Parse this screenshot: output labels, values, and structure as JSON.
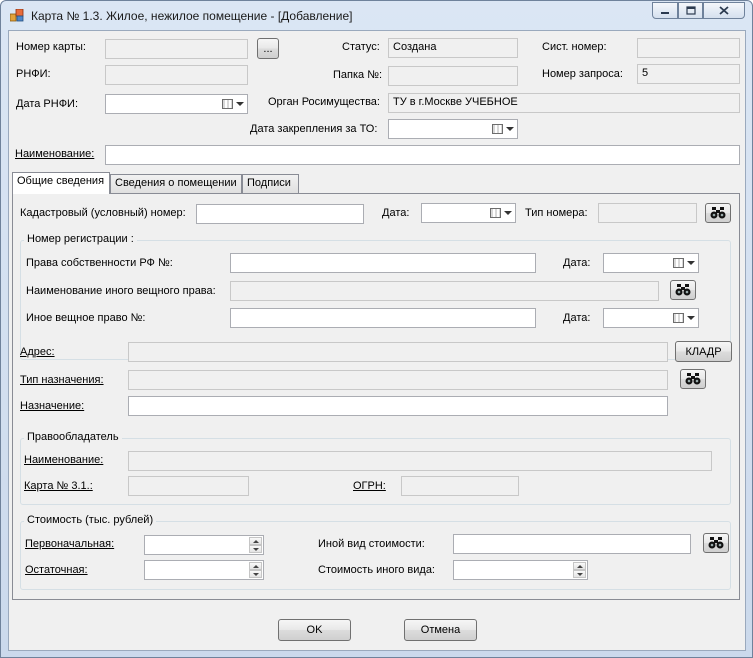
{
  "window": {
    "title": "Карта № 1.3. Жилое, нежилое помещение - [Добавление]",
    "controls": [
      "minimize-icon",
      "maximize-icon",
      "close-icon"
    ]
  },
  "header": {
    "card_number_label": "Номер карты:",
    "card_number_value": "",
    "browse_button_label": "...",
    "status_label": "Статус:",
    "status_value": "Создана",
    "sys_number_label": "Сист. номер:",
    "sys_number_value": "",
    "rnfi_label": "РНФИ:",
    "rnfi_value": "",
    "folder_label": "Папка №:",
    "folder_value": "",
    "request_number_label": "Номер запроса:",
    "request_number_value": "5",
    "rnfi_date_label": "Дата РНФИ:",
    "rnfi_date_value": "",
    "agency_label": "Орган Росимущества:",
    "agency_value": "ТУ в г.Москве УЧЕБНОЕ",
    "assign_date_label": "Дата закрепления за ТО:",
    "assign_date_value": "",
    "name_label": "Наименование:",
    "name_value": ""
  },
  "tabs": [
    {
      "label": "Общие сведения",
      "active": true
    },
    {
      "label": "Сведения о помещении",
      "active": false
    },
    {
      "label": "Подписи",
      "active": false
    }
  ],
  "general": {
    "cadastral_label": "Кадастровый (условный) номер:",
    "cadastral_value": "",
    "date_label": "Дата:",
    "number_type_label": "Тип номера:",
    "number_type_value": "",
    "registration_group": "Номер регистрации :",
    "ownership_rf_label": "Права собственности РФ №:",
    "ownership_rf_value": "",
    "ownership_date_label": "Дата:",
    "other_right_name_label": "Наименование иного вещного права:",
    "other_right_name_value": "",
    "other_right_label": "Иное вещное право  №:",
    "other_right_value": "",
    "other_right_date_label": "Дата:",
    "address_label": "Адрес:",
    "address_value": "",
    "kladr_button_label": "КЛАДР",
    "purpose_type_label": "Тип назначения:",
    "purpose_type_value": "",
    "purpose_label": "Назначение:",
    "purpose_value": "",
    "holder_group": "Правообладатель",
    "holder_name_label": "Наименование:",
    "holder_name_value": "",
    "card31_label": "Карта № 3.1.:",
    "card31_value": "",
    "ogrn_label": "ОГРН:",
    "ogrn_value": "",
    "cost_group": "Стоимость (тыс. рублей)",
    "initial_cost_label": "Первоначальная:",
    "initial_cost_value": "",
    "residual_cost_label": "Остаточная:",
    "residual_cost_value": "",
    "other_cost_kind_label": "Иной вид стоимости:",
    "other_cost_kind_value": "",
    "other_cost_value_label": "Стоимость иного вида:",
    "other_cost_value": ""
  },
  "footer": {
    "ok_label": "OK",
    "cancel_label": "Отмена"
  }
}
